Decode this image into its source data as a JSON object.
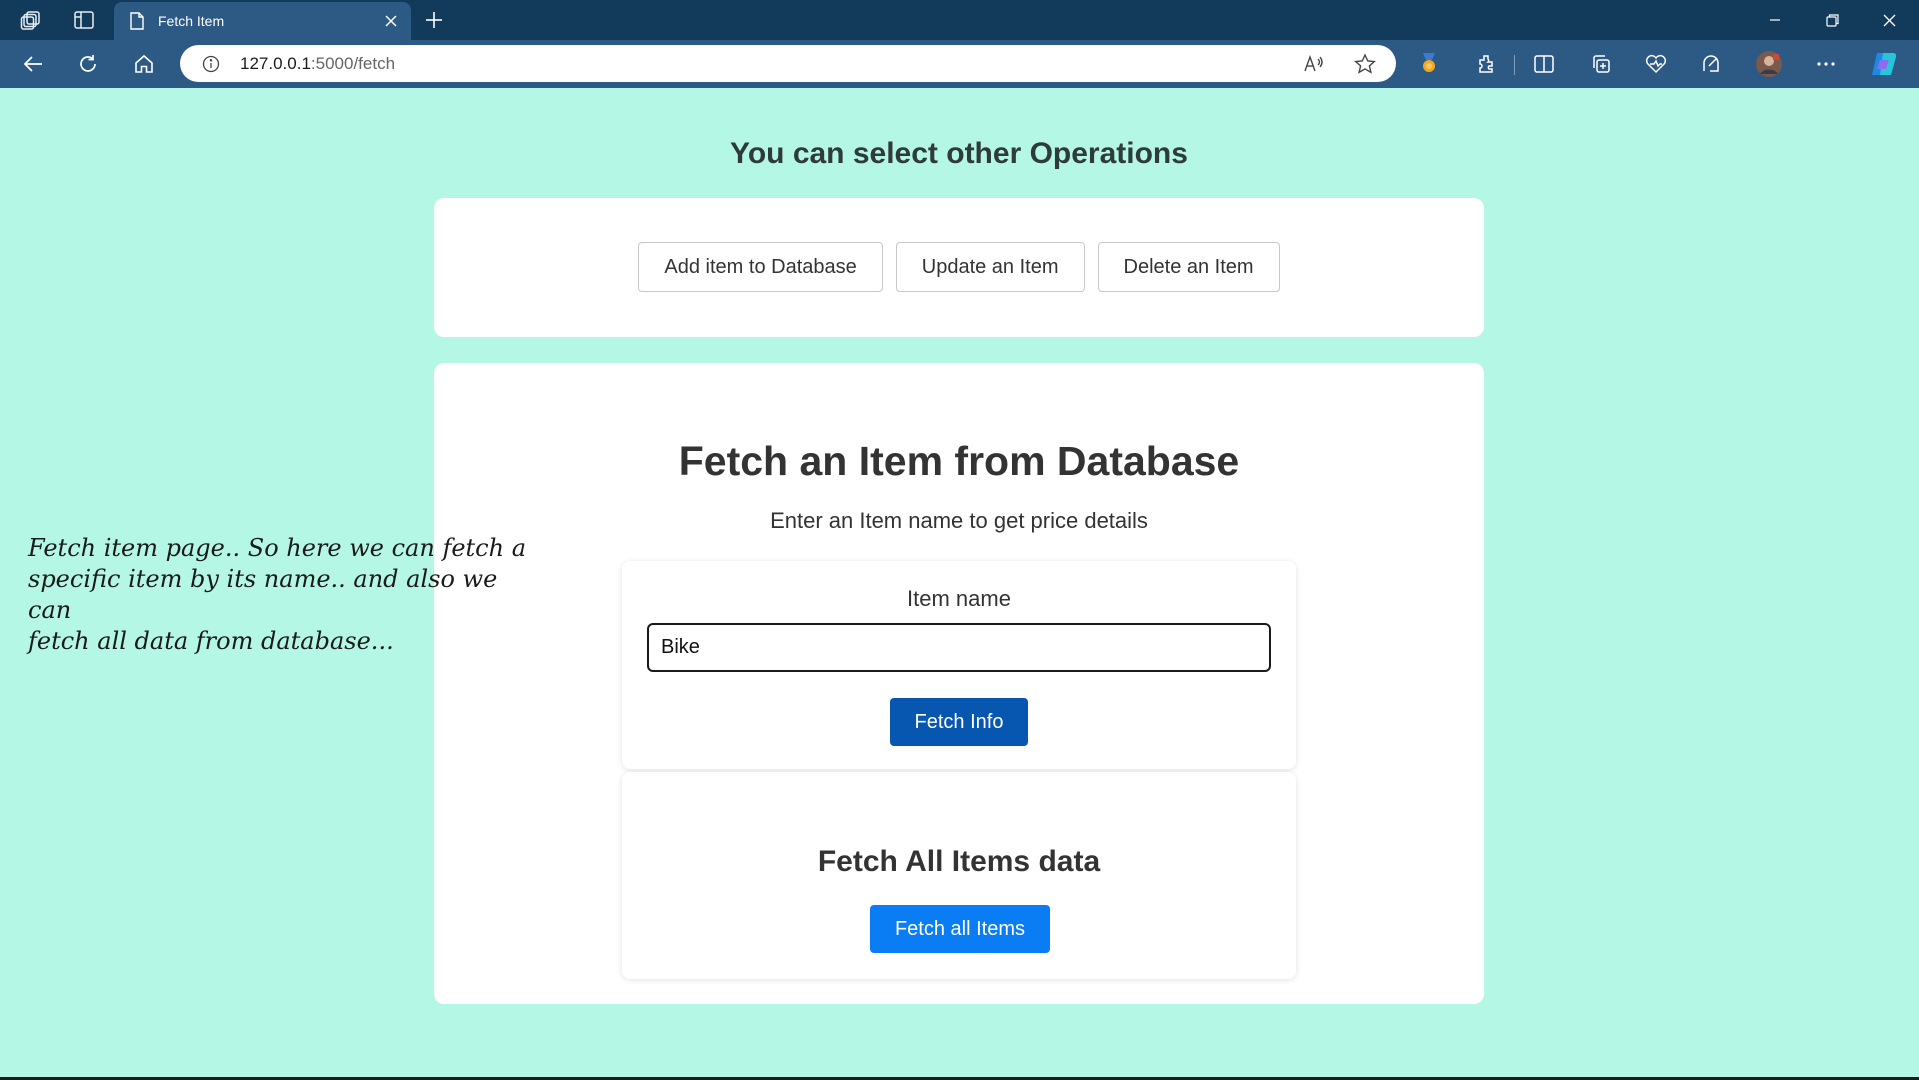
{
  "browser": {
    "tab_title": "Fetch Item",
    "url_host": "127.0.0.1",
    "url_path": ":5000/fetch",
    "icons": [
      "workspaces-icon",
      "tab-actions-icon",
      "page-icon",
      "close-tab-icon",
      "new-tab-icon",
      "back-icon",
      "refresh-icon",
      "home-icon",
      "site-info-icon",
      "read-aloud-icon",
      "favorite-star-icon",
      "rewards-icon",
      "extensions-icon",
      "split-screen-icon",
      "collections-icon",
      "browser-essentials-icon",
      "copilot-drop-icon",
      "profile-avatar",
      "more-options-icon",
      "copilot-icon",
      "minimize-icon",
      "restore-icon",
      "close-window-icon"
    ]
  },
  "page": {
    "ops_heading": "You can select other Operations",
    "operations": [
      {
        "label": "Add item to Database"
      },
      {
        "label": "Update an Item"
      },
      {
        "label": "Delete an Item"
      }
    ],
    "fetch_title": "Fetch an Item from Database",
    "fetch_subtitle": "Enter an Item name to get price details",
    "item_label": "Item name",
    "item_value": "Bike",
    "fetch_info_label": "Fetch Info",
    "fetch_all_title": "Fetch All Items data",
    "fetch_all_label": "Fetch all Items"
  },
  "annotation": "Fetch item page.. So here we can fetch a\nspecific  item by its name.. and also we can\nfetch all data from database...",
  "colors": {
    "page_background": "#b4f7e4",
    "fetch_info_button": "#0757b0",
    "fetch_all_button": "#0a7df5",
    "titlebar": "#123a5a",
    "toolbar": "#2c5a84"
  }
}
